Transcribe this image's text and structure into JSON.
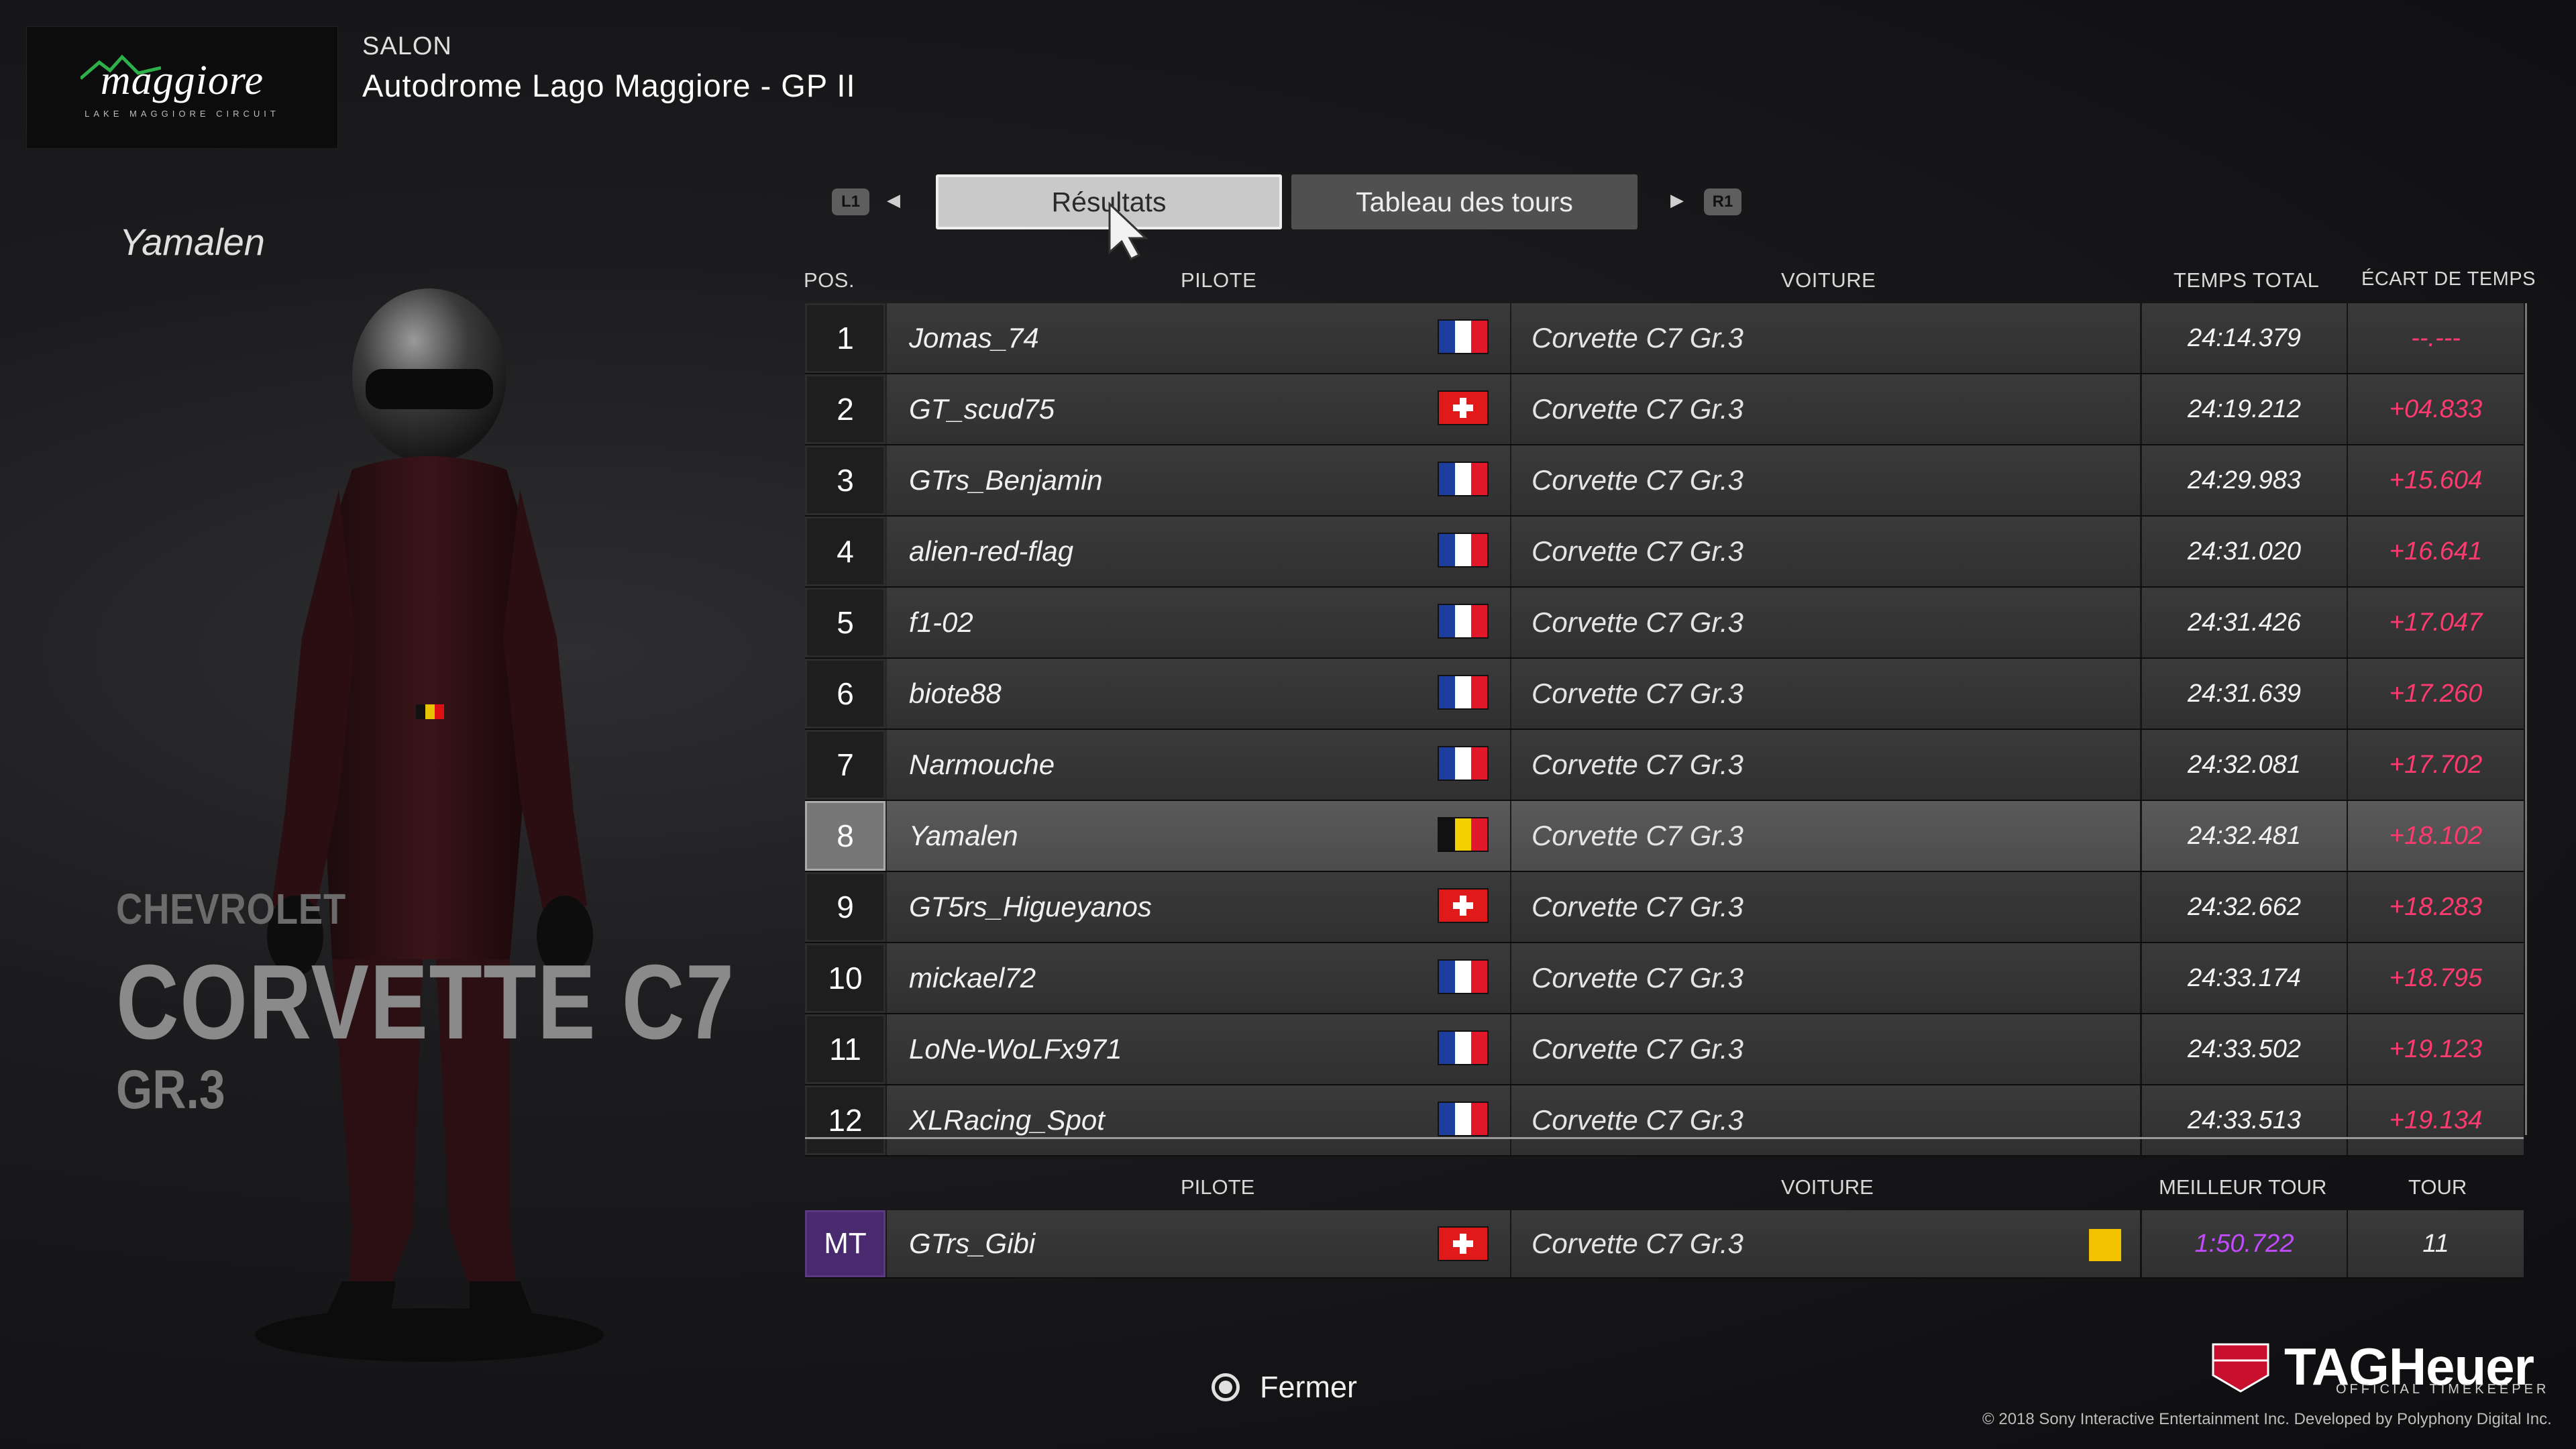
{
  "header": {
    "logo_text": "maggiore",
    "logo_subtext": "LAKE MAGGIORE CIRCUIT",
    "mode": "SALON",
    "track": "Autodrome Lago Maggiore - GP II"
  },
  "driver": {
    "name": "Yamalen",
    "car_brand": "CHEVROLET",
    "car_model": "CORVETTE C7",
    "car_class": "GR.3"
  },
  "tabs": {
    "left_shoulder": "L1",
    "right_shoulder": "R1",
    "items": [
      {
        "label": "Résultats",
        "active": true
      },
      {
        "label": "Tableau des tours",
        "active": false
      }
    ]
  },
  "results": {
    "headers": {
      "pos": "POS.",
      "pilote": "PILOTE",
      "voiture": "VOITURE",
      "temps": "TEMPS TOTAL",
      "ecart": "ÉCART DE TEMPS"
    },
    "rows": [
      {
        "pos": "1",
        "pilote": "Jomas_74",
        "flag": "fr",
        "voiture": "Corvette C7 Gr.3",
        "temps": "24:14.379",
        "ecart": "--.---"
      },
      {
        "pos": "2",
        "pilote": "GT_scud75",
        "flag": "ch",
        "voiture": "Corvette C7 Gr.3",
        "temps": "24:19.212",
        "ecart": "+04.833"
      },
      {
        "pos": "3",
        "pilote": "GTrs_Benjamin",
        "flag": "fr",
        "voiture": "Corvette C7 Gr.3",
        "temps": "24:29.983",
        "ecart": "+15.604"
      },
      {
        "pos": "4",
        "pilote": "alien-red-flag",
        "flag": "fr",
        "voiture": "Corvette C7 Gr.3",
        "temps": "24:31.020",
        "ecart": "+16.641"
      },
      {
        "pos": "5",
        "pilote": "f1-02",
        "flag": "fr",
        "voiture": "Corvette C7 Gr.3",
        "temps": "24:31.426",
        "ecart": "+17.047"
      },
      {
        "pos": "6",
        "pilote": "biote88",
        "flag": "fr",
        "voiture": "Corvette C7 Gr.3",
        "temps": "24:31.639",
        "ecart": "+17.260"
      },
      {
        "pos": "7",
        "pilote": "Narmouche",
        "flag": "fr",
        "voiture": "Corvette C7 Gr.3",
        "temps": "24:32.081",
        "ecart": "+17.702"
      },
      {
        "pos": "8",
        "pilote": "Yamalen",
        "flag": "be",
        "voiture": "Corvette C7 Gr.3",
        "temps": "24:32.481",
        "ecart": "+18.102",
        "highlight": true
      },
      {
        "pos": "9",
        "pilote": "GT5rs_Higueyanos",
        "flag": "ch",
        "voiture": "Corvette C7 Gr.3",
        "temps": "24:32.662",
        "ecart": "+18.283"
      },
      {
        "pos": "10",
        "pilote": "mickael72",
        "flag": "fr",
        "voiture": "Corvette C7 Gr.3",
        "temps": "24:33.174",
        "ecart": "+18.795"
      },
      {
        "pos": "11",
        "pilote": "LoNe-WoLFx971",
        "flag": "fr",
        "voiture": "Corvette C7 Gr.3",
        "temps": "24:33.502",
        "ecart": "+19.123"
      },
      {
        "pos": "12",
        "pilote": "XLRacing_Spot",
        "flag": "fr",
        "voiture": "Corvette C7 Gr.3",
        "temps": "24:33.513",
        "ecart": "+19.134"
      }
    ]
  },
  "best_lap": {
    "headers": {
      "pilote": "PILOTE",
      "voiture": "VOITURE",
      "meilleur": "MEILLEUR TOUR",
      "tour": "TOUR"
    },
    "pos": "MT",
    "pilote": "GTrs_Gibi",
    "flag": "ch",
    "voiture": "Corvette C7 Gr.3",
    "meilleur": "1:50.722",
    "tour": "11"
  },
  "footer": {
    "close_label": "Fermer",
    "brand": "TAGHeuer",
    "brand_sub": "OFFICIAL TIMEKEEPER",
    "copyright": "© 2018 Sony Interactive Entertainment Inc. Developed by Polyphony Digital Inc."
  },
  "colors": {
    "gap_red": "#ff3a6e",
    "best_lap_purple": "#c24bff",
    "mt_badge": "#4a2a6e",
    "highlight_row": "#5a5a5a"
  }
}
